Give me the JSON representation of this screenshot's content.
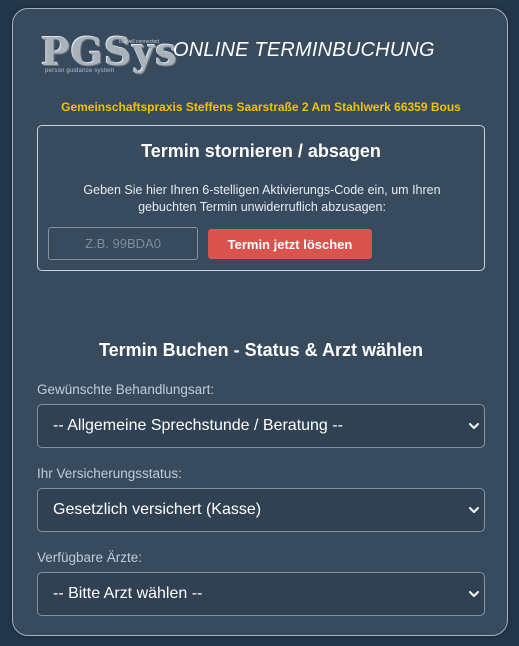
{
  "header": {
    "logo_text": "PGSys",
    "logo_subtext": "person guidance system",
    "logo_tagline": "be well connected",
    "title": "ONLINE TERMINBUCHUNG",
    "practice": "Gemeinschaftspraxis Steffens Saarstraße 2 Am Stahlwerk 66359 Bous"
  },
  "cancel": {
    "title": "Termin stornieren / absagen",
    "description": "Geben Sie hier Ihren 6-stelligen Aktivierungs-Code ein, um Ihren gebuchten Termin unwiderruflich abzusagen:",
    "code_value": "",
    "code_placeholder": "Z.B. 99BDA0",
    "delete_label": "Termin jetzt löschen"
  },
  "booking": {
    "title": "Termin Buchen - Status & Arzt wählen",
    "treatment": {
      "label": "Gewünschte Behandlungsart:",
      "selected": "-- Allgemeine Sprechstunde / Beratung --"
    },
    "insurance": {
      "label": "Ihr Versicherungsstatus:",
      "selected": "Gesetzlich versichert (Kasse)"
    },
    "doctor": {
      "label": "Verfügbare Ärzte:",
      "selected": "-- Bitte Arzt wählen --"
    }
  },
  "icons": {
    "select_chevron": "chevron-down-icon"
  },
  "colors": {
    "background": "#23364a",
    "panel": "#374a5e",
    "accent_yellow": "#f2c200",
    "delete_red": "#d9534f"
  }
}
